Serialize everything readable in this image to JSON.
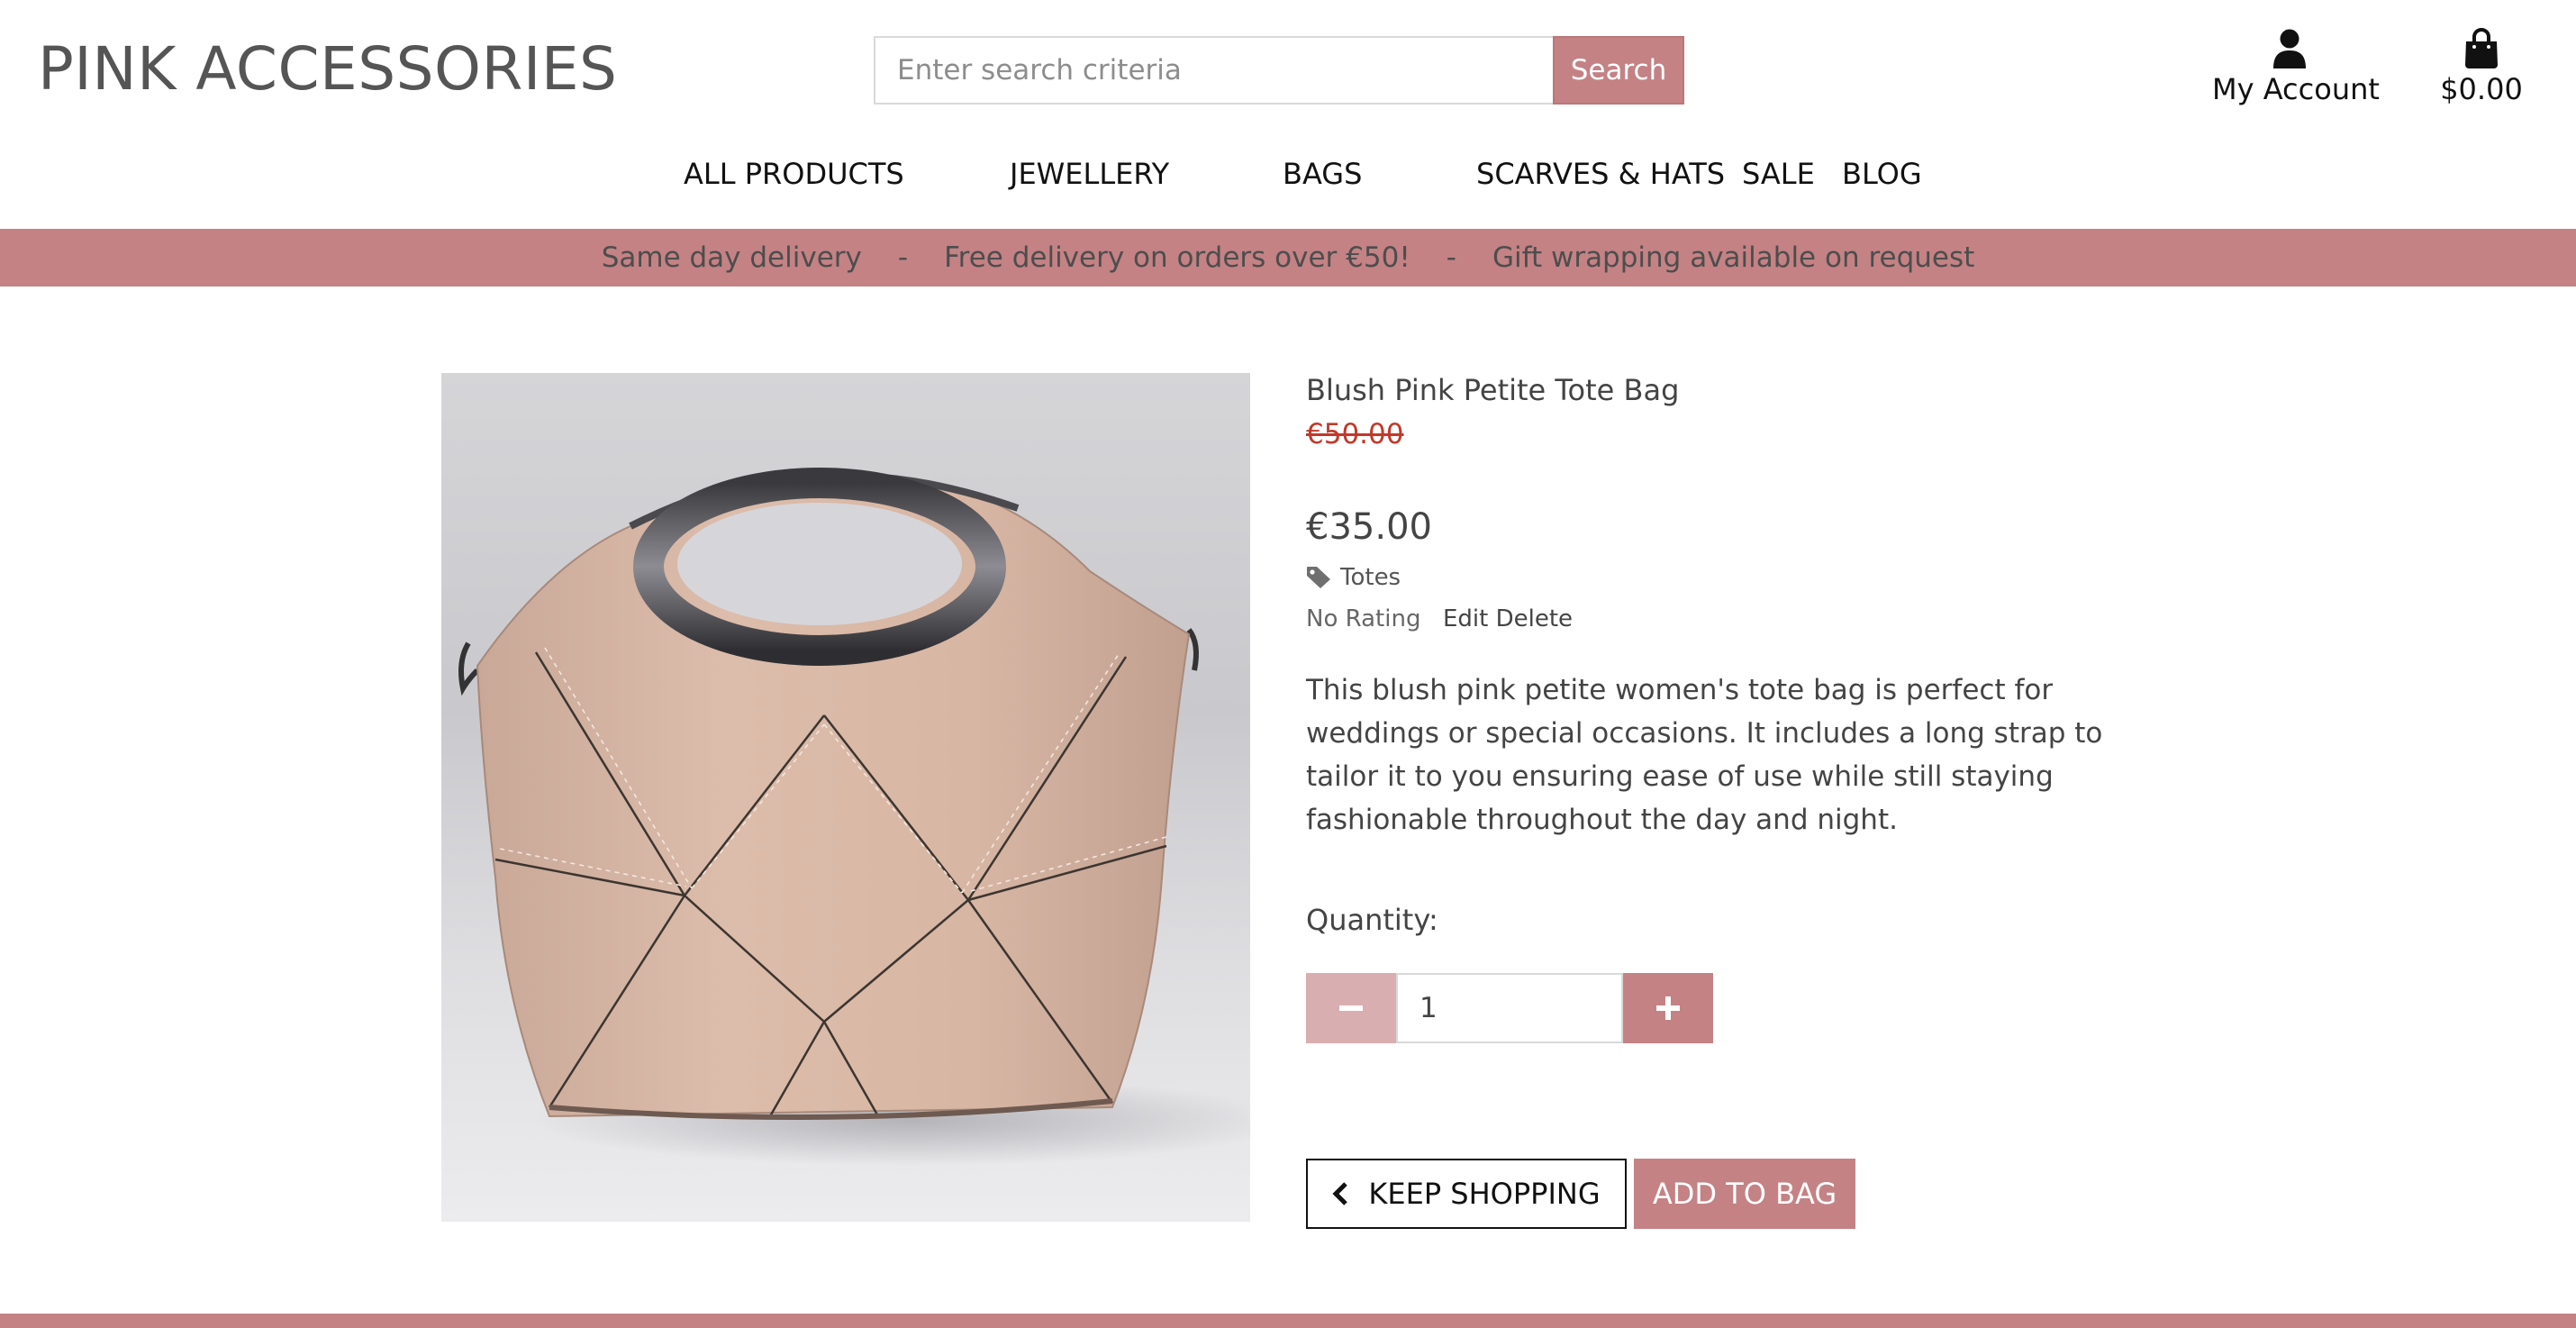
{
  "header": {
    "logo": "PINK ACCESSORIES",
    "search": {
      "placeholder": "Enter search criteria",
      "value": "",
      "button_label": "Search"
    },
    "account": {
      "icon": "user-icon",
      "label": "My Account"
    },
    "bag": {
      "icon": "shopping-bag-icon",
      "label": "$0.00"
    }
  },
  "nav": {
    "items": [
      {
        "label": "ALL PRODUCTS"
      },
      {
        "label": "JEWELLERY"
      },
      {
        "label": "BAGS"
      },
      {
        "label": "SCARVES & HATS"
      },
      {
        "label": "SALE"
      },
      {
        "label": "BLOG"
      }
    ]
  },
  "banner": {
    "items": [
      "Same day delivery",
      "Free delivery on orders over €50!",
      "Gift wrapping available on request"
    ],
    "separator": "-"
  },
  "product": {
    "name": "Blush Pink Petite Tote Bag",
    "old_price": "€50.00",
    "price": "€35.00",
    "category": {
      "icon": "tag-icon",
      "label": "Totes"
    },
    "rating": "No Rating",
    "edit_label": "Edit",
    "delete_label": "Delete",
    "description": "This blush pink petite women's tote bag is perfect for weddings or special occasions. It includes a long strap to tailor it to you ensuring ease of use while still staying fashionable throughout the day and night.",
    "quantity_label": "Quantity:",
    "quantity_value": "1",
    "keep_shopping_label": "KEEP SHOPPING",
    "add_to_bag_label": "ADD TO BAG"
  },
  "colors": {
    "accent": "#c48285",
    "accent_light": "#d9aeb0",
    "sale_price": "#c0392b"
  }
}
